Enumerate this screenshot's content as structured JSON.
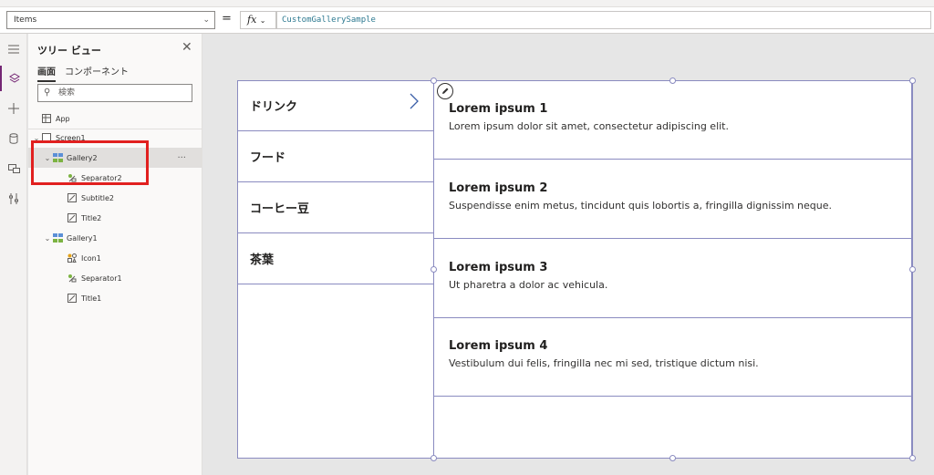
{
  "formula_bar": {
    "property": "Items",
    "equals": "=",
    "fx_label": "fx",
    "formula": "CustomGallerySample"
  },
  "left_rail": {
    "icons": [
      "hamburger-icon",
      "layers-icon",
      "plus-icon",
      "database-icon",
      "media-icon",
      "tools-icon"
    ]
  },
  "tree_view": {
    "title": "ツリー ビュー",
    "tabs": [
      "画面",
      "コンポーネント"
    ],
    "search_placeholder": "検索",
    "nodes": [
      {
        "label": "App"
      },
      {
        "label": "Screen1"
      },
      {
        "label": "Gallery2"
      },
      {
        "label": "Separator2"
      },
      {
        "label": "Subtitle2"
      },
      {
        "label": "Title2"
      },
      {
        "label": "Gallery1"
      },
      {
        "label": "Icon1"
      },
      {
        "label": "Separator1"
      },
      {
        "label": "Title1"
      }
    ],
    "more_label": "···"
  },
  "canvas": {
    "categories": [
      "ドリンク",
      "フード",
      "コーヒー豆",
      "茶葉"
    ],
    "items": [
      {
        "title": "Lorem ipsum 1",
        "subtitle": "Lorem ipsum dolor sit amet, consectetur adipiscing elit."
      },
      {
        "title": "Lorem ipsum 2",
        "subtitle": "Suspendisse enim metus, tincidunt quis lobortis a, fringilla dignissim neque."
      },
      {
        "title": "Lorem ipsum 3",
        "subtitle": "Ut pharetra a dolor ac vehicula."
      },
      {
        "title": "Lorem ipsum 4",
        "subtitle": "Vestibulum dui felis, fringilla nec mi sed, tristique dictum nisi."
      }
    ]
  },
  "colors": {
    "accent": "#742774",
    "gallery_border": "#8a8bc0",
    "highlight_box": "#e1201f"
  }
}
